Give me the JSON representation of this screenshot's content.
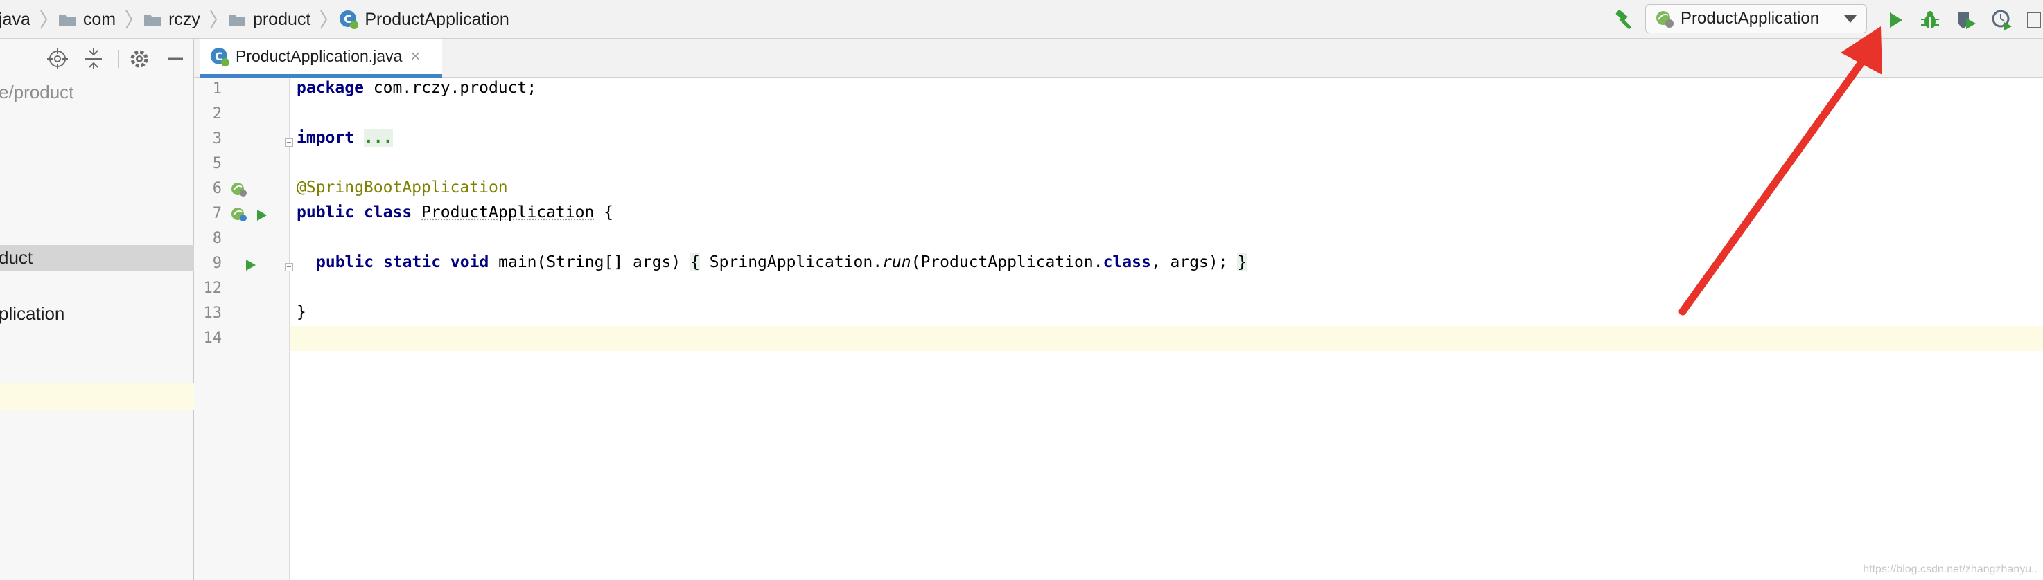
{
  "breadcrumbs": {
    "items": [
      {
        "label": "java",
        "icon": "none"
      },
      {
        "label": "com",
        "icon": "folder-icon"
      },
      {
        "label": "rczy",
        "icon": "folder-icon"
      },
      {
        "label": "product",
        "icon": "folder-icon"
      },
      {
        "label": "ProductApplication",
        "icon": "spring-class-icon"
      }
    ]
  },
  "toolbar": {
    "run_config_label": "ProductApplication",
    "buttons": [
      "build-hammer-icon",
      "run-icon",
      "debug-icon",
      "coverage-icon",
      "profile-icon"
    ]
  },
  "project_panel": {
    "path_text": "e/product",
    "selected_item": "duct",
    "item_below": "plication"
  },
  "editor_tab": {
    "label": "ProductApplication.java",
    "close_glyph": "×"
  },
  "code": {
    "line_numbers": [
      "1",
      "2",
      "3",
      "5",
      "6",
      "7",
      "8",
      "9",
      "12",
      "13",
      "14"
    ],
    "package_kw": "package",
    "package_name": " com.rczy.product;",
    "import_kw": "import",
    "import_ellipsis": "...",
    "annotation": "@SpringBootApplication",
    "public_kw": "public",
    "class_kw": "class",
    "class_name": "ProductApplication",
    "open_brace": " {",
    "static_kw": "static",
    "void_kw": "void",
    "main_sig": " main(String[] args) ",
    "fold_open": "{",
    "spring_app": " SpringApplication.",
    "run_call": "run",
    "run_args_a": "(ProductApplication.",
    "run_args_b": ", args);",
    "fold_close": "}",
    "close_brace": "}"
  },
  "watermark": "https://blog.csdn.net/zhangzhanyu..",
  "colors": {
    "keyword": "#000080",
    "annotation": "#808000",
    "run_green": "#3a9f3a",
    "arrow_red": "#e8332b",
    "caret_line": "#fdfbe4"
  }
}
